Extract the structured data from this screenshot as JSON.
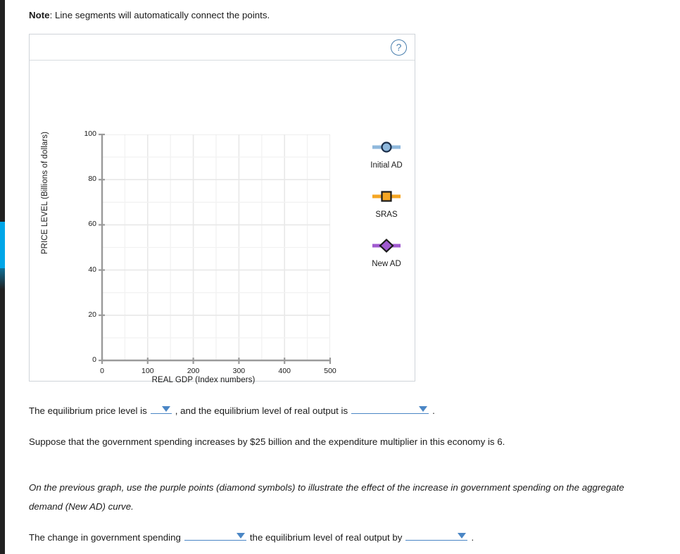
{
  "note": {
    "label": "Note",
    "text": ": Line segments will automatically connect the points."
  },
  "graph_panel": {
    "help_icon": "?"
  },
  "chart_data": {
    "type": "scatter",
    "title": "",
    "xlabel": "REAL GDP (Index numbers)",
    "ylabel": "PRICE LEVEL (Billions of dollars)",
    "xlim": [
      0,
      500
    ],
    "ylim": [
      0,
      100
    ],
    "xticks": [
      0,
      100,
      200,
      300,
      400,
      500
    ],
    "yticks": [
      0,
      20,
      40,
      60,
      80,
      100
    ],
    "x_minor_step": 50,
    "y_minor_step": 10,
    "grid": true,
    "legend_position": "right",
    "series": [
      {
        "name": "Initial AD",
        "marker": "circle",
        "color": "#8fb8dc",
        "edge": "#1a2e4a",
        "values": []
      },
      {
        "name": "SRAS",
        "marker": "square",
        "color": "#f5a623",
        "edge": "#1a1a1a",
        "values": []
      },
      {
        "name": "New AD",
        "marker": "diamond",
        "color": "#a05ad0",
        "edge": "#1a1a1a",
        "values": []
      }
    ]
  },
  "question_1": {
    "part_a": "The equilibrium price level is",
    "part_b": ", and the equilibrium level of real output is",
    "part_c": ".",
    "dropdown_1_value": "",
    "dropdown_2_value": ""
  },
  "paragraph_suppose": "Suppose that the government spending increases by $25 billion and the expenditure multiplier in this economy is 6.",
  "paragraph_italic": "On the previous graph, use the purple points (diamond symbols) to illustrate the effect of the increase in government spending on the aggregate demand (New AD) curve.",
  "question_2": {
    "part_a": "The change in government spending",
    "part_b": "the equilibrium level of real output by",
    "part_c": ".",
    "dropdown_1_value": "",
    "dropdown_2_value": ""
  },
  "colors": {
    "accent_blue": "#4a86c5",
    "initial_ad": "#8fb8dc",
    "sras": "#f5a623",
    "new_ad": "#a05ad0",
    "sidebar_highlight": "#00a6e8"
  }
}
